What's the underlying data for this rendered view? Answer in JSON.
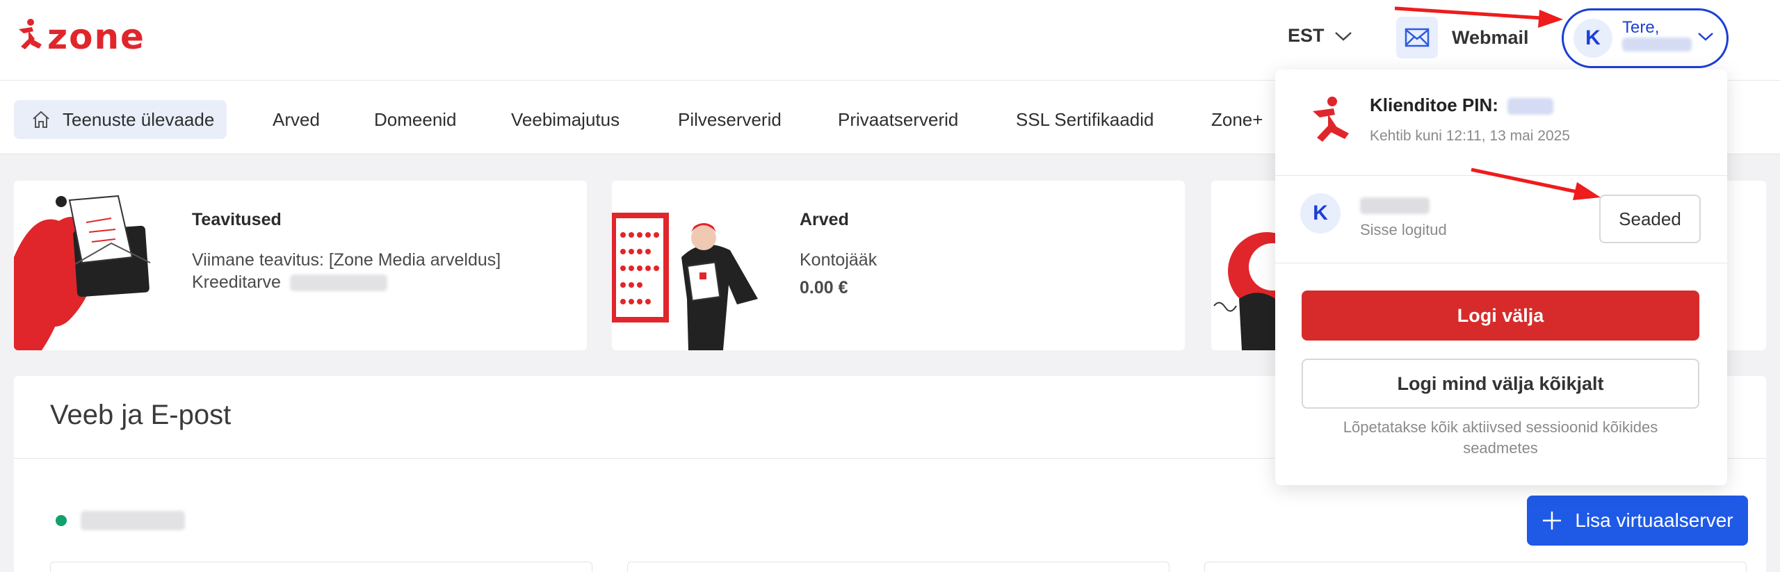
{
  "brand": {
    "name": "zone",
    "color": "#e0262b"
  },
  "header": {
    "language": "EST",
    "webmail_label": "Webmail",
    "user": {
      "initial": "K",
      "greeting": "Tere,"
    }
  },
  "nav": {
    "items": [
      {
        "label": "Teenuste ülevaade",
        "icon": "home-icon",
        "active": true
      },
      {
        "label": "Arved"
      },
      {
        "label": "Domeenid"
      },
      {
        "label": "Veebimajutus"
      },
      {
        "label": "Pilveserverid"
      },
      {
        "label": "Privaatserverid"
      },
      {
        "label": "SSL Sertifikaadid"
      },
      {
        "label": "Zone+"
      }
    ]
  },
  "cards": [
    {
      "title": "Teavitused",
      "line1": "Viimane teavitus: [Zone Media arveldus]",
      "line2": "Kreeditarve"
    },
    {
      "title": "Arved",
      "line1": "Kontojääk",
      "value": "0.00 €"
    }
  ],
  "section": {
    "title": "Veeb ja E-post",
    "add_button": "Lisa virtuaalserver",
    "status_color": "#12a06b"
  },
  "dropdown": {
    "pin_label": "Klienditoe PIN:",
    "pin_expiry": "Kehtib kuni 12:11, 13 mai 2025",
    "user_initial": "K",
    "user_status": "Sisse logitud",
    "settings_button": "Seaded",
    "logout_button": "Logi välja",
    "logout_all_button": "Logi mind välja kõikjalt",
    "logout_all_note": "Lõpetatakse kõik aktiivsed sessioonid kõikides seadmetes"
  },
  "colors": {
    "accent_blue": "#1c3fd6",
    "primary_button": "#1f5ae6",
    "danger": "#d72b2b",
    "annotation_arrow": "#ee1c1c"
  }
}
